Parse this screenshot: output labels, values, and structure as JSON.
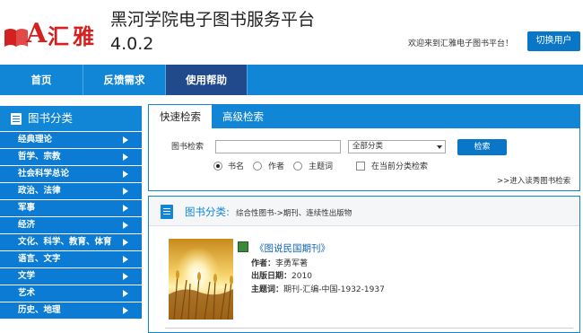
{
  "header": {
    "logo_mark": "A",
    "logo_text": "汇雅",
    "title": "黑河学院电子图书服务平台",
    "version": "4.0.2",
    "welcome": "欢迎来到汇雅电子图书平台！",
    "switch_user": "切换用户"
  },
  "nav": {
    "items": [
      "首页",
      "反馈需求",
      "使用帮助"
    ],
    "active_index": 2
  },
  "sidebar": {
    "title": "图书分类",
    "items": [
      "经典理论",
      "哲学、宗教",
      "社会科学总论",
      "政治、法律",
      "军事",
      "经济",
      "文化、科学、教育、体育",
      "语言、文字",
      "文学",
      "艺术",
      "历史、地理"
    ]
  },
  "search": {
    "tabs": [
      "快速检索",
      "高级检索"
    ],
    "label": "图书检索",
    "keyword_value": "",
    "category_selected": "全部分类",
    "button": "检索",
    "radio_options": [
      "书名",
      "作者",
      "主题词"
    ],
    "radio_selected": 0,
    "checkbox_label": "在当前分类检索",
    "checkbox_checked": false,
    "advanced_link": ">>进入读秀图书检索"
  },
  "results": {
    "category_label": "图书分类:",
    "category_path": "综合性图书->期刊、连续性出版物",
    "books": [
      {
        "title": "《图说民国期刊》",
        "author_label": "作者：",
        "author": "李勇军著",
        "date_label": "出版日期：",
        "date": "2010",
        "subject_label": "主题词：",
        "subject": "期刊-汇编-中国-1932-1937"
      }
    ]
  },
  "colors": {
    "primary": "#1286d6",
    "nav_active": "#214a8c",
    "logo_red": "#d32020",
    "link": "#1164b4"
  }
}
